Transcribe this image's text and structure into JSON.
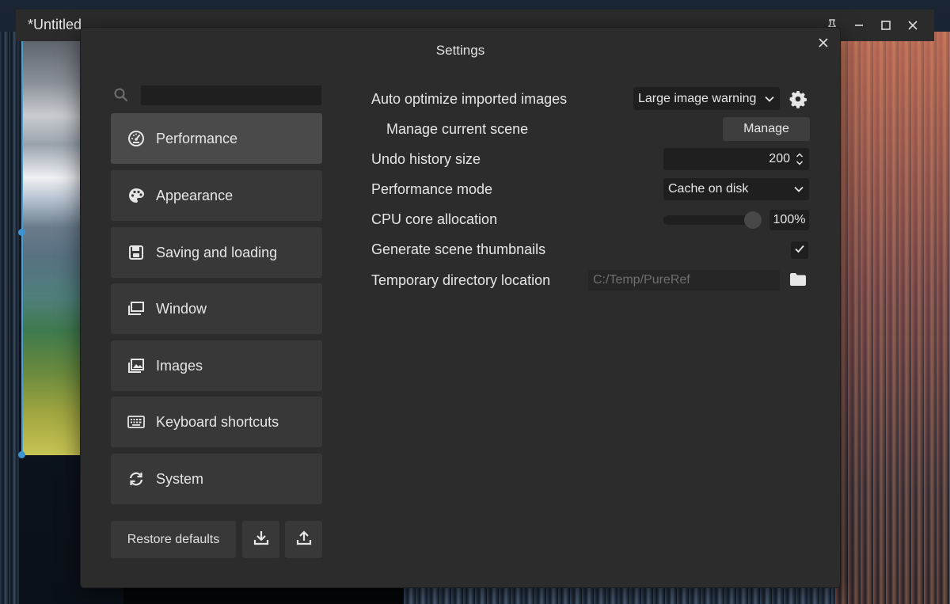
{
  "app": {
    "title": "*Untitled",
    "window_controls": [
      "pin-icon",
      "minimize-icon",
      "maximize-icon",
      "close-icon"
    ]
  },
  "dialog": {
    "title": "Settings",
    "close_icon": "close-icon"
  },
  "search": {
    "placeholder": "",
    "value": ""
  },
  "sidebar": {
    "items": [
      {
        "label": "Performance",
        "icon": "gauge-icon",
        "active": true
      },
      {
        "label": "Appearance",
        "icon": "palette-icon",
        "active": false
      },
      {
        "label": "Saving and loading",
        "icon": "floppy-disk-icon",
        "active": false
      },
      {
        "label": "Window",
        "icon": "window-icon",
        "active": false
      },
      {
        "label": "Images",
        "icon": "images-icon",
        "active": false
      },
      {
        "label": "Keyboard shortcuts",
        "icon": "keyboard-icon",
        "active": false
      },
      {
        "label": "System",
        "icon": "sync-icon",
        "active": false
      }
    ],
    "restore_label": "Restore defaults",
    "import_icon": "download-icon",
    "export_icon": "upload-icon"
  },
  "settings": {
    "auto_optimize": {
      "label": "Auto optimize imported images",
      "value": "Large image warning"
    },
    "manage_scene": {
      "label": "Manage current scene",
      "button": "Manage"
    },
    "undo_history": {
      "label": "Undo history size",
      "value": "200"
    },
    "performance_mode": {
      "label": "Performance mode",
      "value": "Cache on disk"
    },
    "cpu_allocation": {
      "label": "CPU core allocation",
      "value": "100%",
      "level": 1.0
    },
    "scene_thumbnails": {
      "label": "Generate scene thumbnails",
      "checked": true
    },
    "temp_dir": {
      "label": "Temporary directory location",
      "placeholder": "C:/Temp/PureRef"
    }
  },
  "colors": {
    "dialog_bg": "#2c2c2c",
    "nav_bg": "#383838",
    "nav_active_bg": "#4a4a4a",
    "field_bg": "#1f1f1f",
    "text": "#e6e6e6",
    "selection_accent": "#3b94cf"
  }
}
